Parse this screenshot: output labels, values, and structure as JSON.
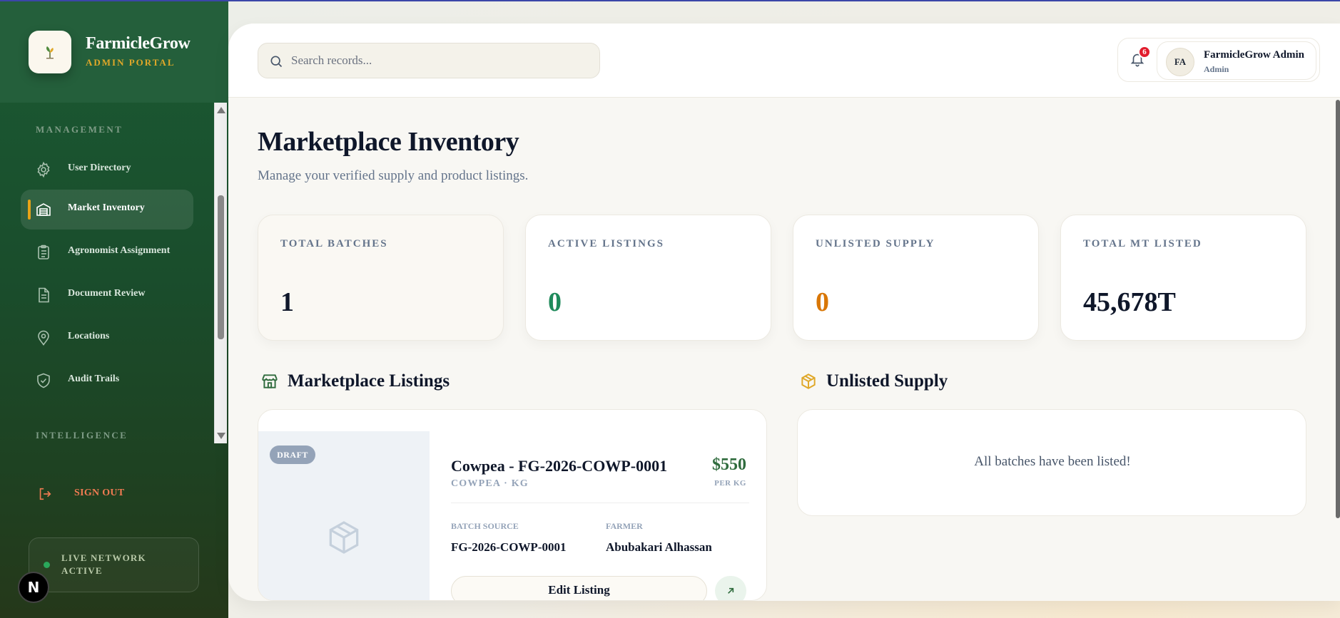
{
  "brand": {
    "name": "FarmicleGrow",
    "subtitle": "ADMIN PORTAL"
  },
  "sidebar": {
    "sections": {
      "management": "MANAGEMENT",
      "intelligence": "INTELLIGENCE"
    },
    "items": [
      {
        "label": "User Directory",
        "icon": "gear-icon"
      },
      {
        "label": "Market Inventory",
        "icon": "warehouse-icon",
        "active": true
      },
      {
        "label": "Agronomist Assignment",
        "icon": "clipboard-icon"
      },
      {
        "label": "Document Review",
        "icon": "document-icon"
      },
      {
        "label": "Locations",
        "icon": "map-pin-icon"
      },
      {
        "label": "Audit Trails",
        "icon": "shield-check-icon"
      }
    ],
    "sign_out": "SIGN OUT",
    "live_status": "LIVE NETWORK ACTIVE",
    "dev_badge": "N"
  },
  "header": {
    "search_placeholder": "Search records...",
    "notification_count": "6",
    "user": {
      "initials": "FA",
      "name": "FarmicleGrow Admin",
      "role": "Admin"
    }
  },
  "page": {
    "title": "Marketplace Inventory",
    "subtitle": "Manage your verified supply and product listings."
  },
  "stats": [
    {
      "label": "TOTAL BATCHES",
      "value": "1",
      "color": "#0f172a"
    },
    {
      "label": "ACTIVE LISTINGS",
      "value": "0",
      "color": "#1f8a5b"
    },
    {
      "label": "UNLISTED SUPPLY",
      "value": "0",
      "color": "#d97706"
    },
    {
      "label": "TOTAL MT LISTED",
      "value": "45,678T",
      "color": "#0f172a"
    }
  ],
  "listings": {
    "title": "Marketplace Listings",
    "items": [
      {
        "status": "DRAFT",
        "title": "Cowpea - FG-2026-COWP-0001",
        "subtitle": "COWPEA · KG",
        "price": "$550",
        "price_unit": "PER KG",
        "batch_source_label": "BATCH SOURCE",
        "batch_source": "FG-2026-COWP-0001",
        "farmer_label": "FARMER",
        "farmer": "Abubakari Alhassan",
        "edit_label": "Edit Listing"
      }
    ]
  },
  "unlisted": {
    "title": "Unlisted Supply",
    "empty_message": "All batches have been listed!"
  },
  "colors": {
    "sidebar_green": "#1b5a33",
    "accent_gold": "#e0a829",
    "signout": "#f07b52",
    "price_green": "#2f6b3d"
  }
}
